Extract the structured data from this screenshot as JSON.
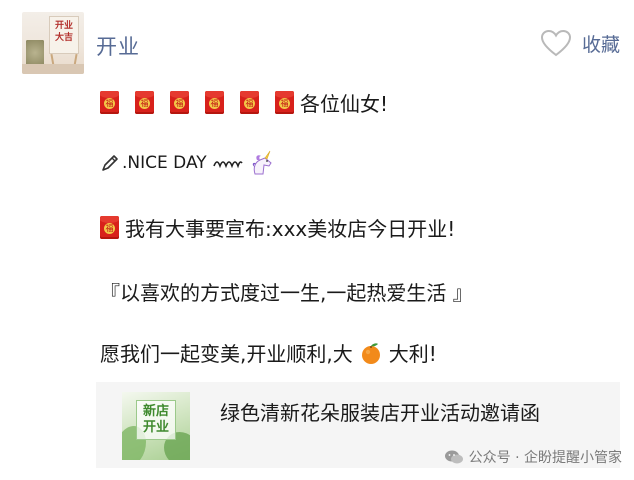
{
  "account": {
    "name": "开业",
    "avatar_text": "开业\n大吉",
    "favorite_label": "收藏"
  },
  "post": {
    "greeting": "各位仙女!",
    "nice_day": ".NICE DAY",
    "announce": "我有大事要宣布:xxx美妆店今日开业!",
    "motto": "『以喜欢的方式度过一生,一起热爱生活 』",
    "wish_a": "愿我们一起变美,开业顺利,大",
    "wish_b": "大利!"
  },
  "card": {
    "thumb_text": "新店\n开业",
    "title": "绿色清新花朵服装店开业活动邀请函"
  },
  "watermark": {
    "text": "公众号 · 企盼提醒小管家"
  },
  "icons": {
    "envelope": "red-envelope-icon",
    "pencil": "pencil-icon",
    "squiggle": "squiggle-icon",
    "unicorn": "unicorn-icon",
    "orange": "tangerine-icon",
    "heart": "heart-outline-icon",
    "wechat": "wechat-logo-icon"
  },
  "colors": {
    "link": "#576b95",
    "envelope": "#d8211b",
    "card_bg": "#f5f5f5"
  }
}
